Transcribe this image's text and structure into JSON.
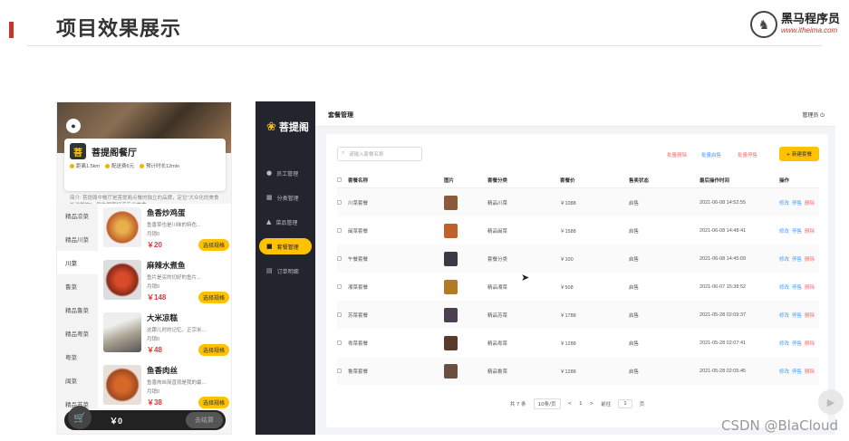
{
  "slide": {
    "title": "项目效果展示"
  },
  "brand": {
    "name": "黑马程序员",
    "url": "www.itheima.com"
  },
  "phone": {
    "store_name": "菩提阁餐厅",
    "meta": [
      "距离1.5km",
      "配送费6元",
      "预计时长12min"
    ],
    "intro": "简介: 菩提阁中餐厅是菩提阁点餐的独立的品牌，定位\"大众化的美食外送餐饮\"，旨为顾客打造专业美食。",
    "categories": [
      "精品凉菜",
      "精品川菜",
      "川菜",
      "鲁菜",
      "精品鲁菜",
      "精品粤菜",
      "粤菜",
      "闽菜",
      "精品苏菜"
    ],
    "active_category_index": 2,
    "dishes": [
      {
        "name": "鱼香炒鸡蛋",
        "desc": "鱼香菜也是川味的特色...",
        "sales": "月销0",
        "price": "￥20",
        "button": "选择规格"
      },
      {
        "name": "麻辣水煮鱼",
        "desc": "鱼片是买的切好的鱼片...",
        "sales": "月销0",
        "price": "￥148",
        "button": "选择规格"
      },
      {
        "name": "大米凉糕",
        "desc": "这跟儿时的记忆。正宗米...",
        "sales": "月销0",
        "price": "￥48",
        "button": "选择规格"
      },
      {
        "name": "鱼香肉丝",
        "desc": "鱼香肉丝简直就是我的最...",
        "sales": "月销0",
        "price": "￥38",
        "button": "选择规格"
      }
    ],
    "cart_total": "￥0",
    "checkout": "去结算"
  },
  "admin": {
    "logo": "菩提阁",
    "nav": [
      {
        "label": "员工管理",
        "icon": "user-icon"
      },
      {
        "label": "分类管理",
        "icon": "grid-icon"
      },
      {
        "label": "菜品管理",
        "icon": "dish-icon"
      },
      {
        "label": "套餐管理",
        "icon": "bag-icon"
      },
      {
        "label": "订单明细",
        "icon": "order-icon"
      }
    ],
    "active_nav_index": 3,
    "top_title": "套餐管理",
    "user": "管理员",
    "search_placeholder": "请输入套餐名称",
    "batch_delete": "批量删除",
    "batch_enable": "批量启售",
    "batch_disable": "批量停售",
    "new_button": "+ 新建套餐",
    "columns": [
      "套餐名称",
      "图片",
      "套餐分类",
      "套餐价",
      "售卖状态",
      "最后操作时间",
      "操作"
    ],
    "rows": [
      {
        "name": "川菜套餐",
        "cat": "精品川菜",
        "price": "￥1088",
        "status": "启售",
        "time": "2021-06-08 14:52:55",
        "img": "#8a5a3a"
      },
      {
        "name": "闽菜套餐",
        "cat": "精品闽菜",
        "price": "￥1588",
        "status": "启售",
        "time": "2021-06-08 14:48:41",
        "img": "#c0602a"
      },
      {
        "name": "午餐套餐",
        "cat": "套餐分类",
        "price": "￥100",
        "status": "启售",
        "time": "2021-06-08 14:45:09",
        "img": "#3a3a44"
      },
      {
        "name": "湘菜套餐",
        "cat": "精品湘菜",
        "price": "￥508",
        "status": "启售",
        "time": "2021-06-07 15:38:52",
        "img": "#b07a2a"
      },
      {
        "name": "苏菜套餐",
        "cat": "精品苏菜",
        "price": "￥1788",
        "status": "启售",
        "time": "2021-05-28 02:09:37",
        "img": "#4a4050"
      },
      {
        "name": "粤菜套餐",
        "cat": "精品粤菜",
        "price": "￥1288",
        "status": "启售",
        "time": "2021-05-28 02:07:41",
        "img": "#5a3a2a"
      },
      {
        "name": "鲁菜套餐",
        "cat": "精品鲁菜",
        "price": "￥1288",
        "status": "启售",
        "time": "2021-05-28 02:05:45",
        "img": "#6a5040"
      }
    ],
    "row_actions": [
      "修改",
      "停售",
      "删除"
    ],
    "pager": {
      "total": "共 7 条",
      "size": "10条/页",
      "prev": "<",
      "page": "1",
      "next": ">",
      "goto": "前往",
      "jump": "1",
      "unit": "页"
    }
  },
  "watermark": "CSDN @BlaCloud"
}
